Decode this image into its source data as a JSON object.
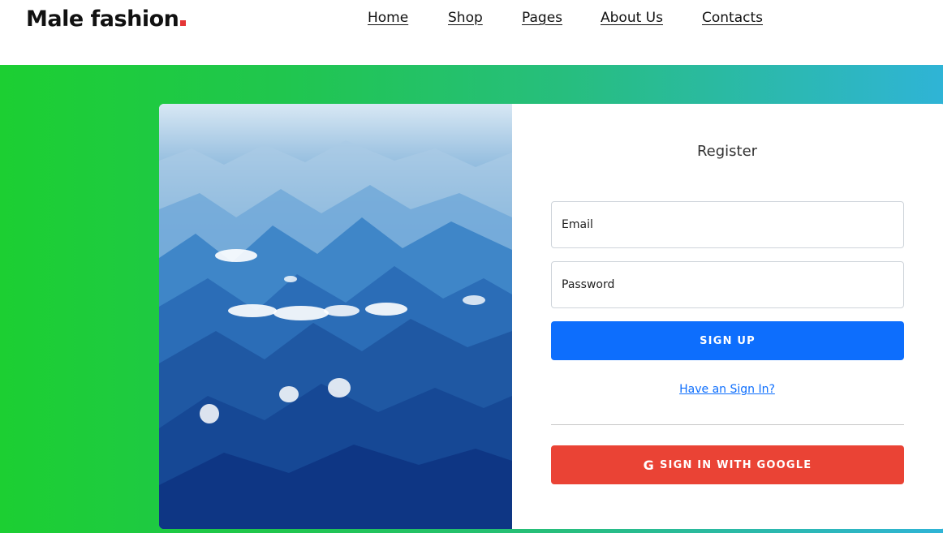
{
  "header": {
    "brand": "Male fashion",
    "nav": [
      "Home",
      "Shop",
      "Pages",
      "About Us",
      "Contacts"
    ]
  },
  "form": {
    "title": "Register",
    "email_placeholder": "Email",
    "password_placeholder": "Password",
    "signup_label": "SIGN UP",
    "signin_link": "Have an Sign In?",
    "google_icon": "G",
    "google_label": "SIGN IN WITH GOOGLE"
  },
  "colors": {
    "brand_dot": "#e53637",
    "primary_button": "#0d6efd",
    "google_button": "#ea4335",
    "gradient_start": "#1ccf32",
    "gradient_end": "#2fb4d6"
  },
  "icons": {
    "google": "google-g-icon",
    "logo_dot": "red-square"
  }
}
